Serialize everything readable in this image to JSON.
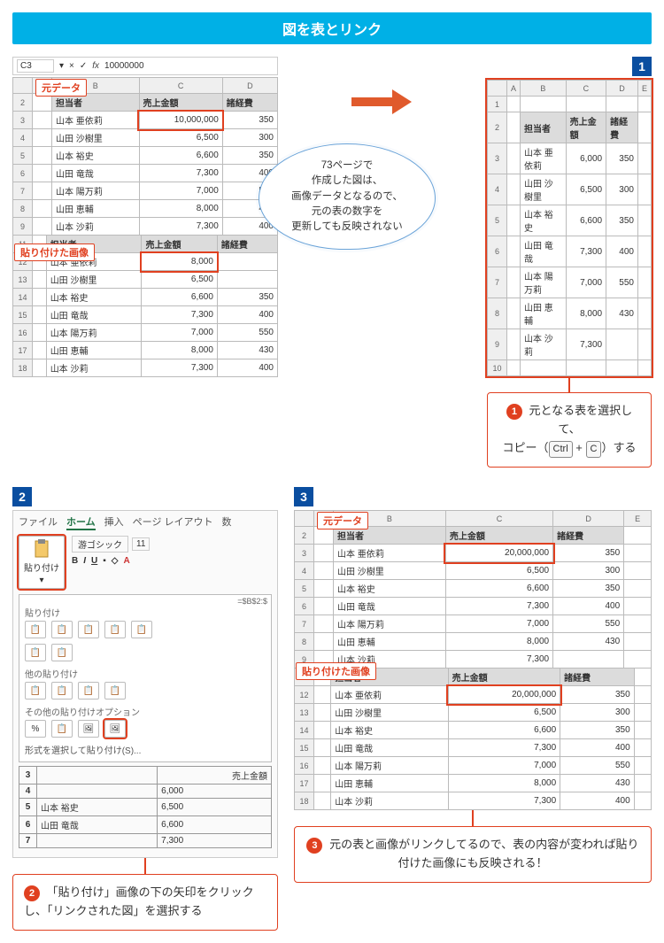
{
  "title": "図を表とリンク",
  "steps": {
    "s1": "1",
    "s2": "2",
    "s3": "3"
  },
  "badge_num": {
    "b1": "1",
    "b2": "2",
    "b3": "3"
  },
  "labels": {
    "source_data": "元データ",
    "pasted_image": "貼り付けた画像"
  },
  "bubble_text": "73ページで\n作成した図は、\n画像データとなるので、\n元の表の数字を\n更新しても反映されない",
  "callout1": {
    "pre": "元となる表を選択して、\nコピー（",
    "k1": "Ctrl",
    "plus": "+",
    "k2": "C",
    "post": "）する"
  },
  "callout2": "「貼り付け」画像の下の矢印をクリックし、「リンクされた図」を選択する",
  "callout3": "元の表と画像がリンクしてるので、表の内容が変われば貼り付けた画像にも反映される！",
  "formula": {
    "cellref": "C3",
    "fx_value": "10000000"
  },
  "columns": [
    "A",
    "B",
    "C",
    "D",
    "E"
  ],
  "headers": {
    "person": "担当者",
    "sales": "売上金額",
    "expense": "諸経費"
  },
  "table_original": [
    {
      "row": 3,
      "name": "山本 亜依莉",
      "sales": "10,000,000",
      "exp": "350"
    },
    {
      "row": 4,
      "name": "山田 沙樹里",
      "sales": "6,500",
      "exp": "300"
    },
    {
      "row": 5,
      "name": "山本 裕史",
      "sales": "6,600",
      "exp": "350"
    },
    {
      "row": 6,
      "name": "山田 竜哉",
      "sales": "7,300",
      "exp": "400"
    },
    {
      "row": 7,
      "name": "山本 陽万莉",
      "sales": "7,000",
      "exp": "550"
    },
    {
      "row": 8,
      "name": "山田 恵輔",
      "sales": "8,000",
      "exp": "430"
    },
    {
      "row": 9,
      "name": "山本 沙莉",
      "sales": "7,300",
      "exp": "400"
    }
  ],
  "table_pasted": [
    {
      "row": 12,
      "name": "山本 亜依莉",
      "sales": "8,000",
      "exp": ""
    },
    {
      "row": 13,
      "name": "山田 沙樹里",
      "sales": "6,500",
      "exp": ""
    },
    {
      "row": 14,
      "name": "山本 裕史",
      "sales": "6,600",
      "exp": "350"
    },
    {
      "row": 15,
      "name": "山田 竜哉",
      "sales": "7,300",
      "exp": "400"
    },
    {
      "row": 16,
      "name": "山本 陽万莉",
      "sales": "7,000",
      "exp": "550"
    },
    {
      "row": 17,
      "name": "山田 恵輔",
      "sales": "8,000",
      "exp": "430"
    },
    {
      "row": 18,
      "name": "山本 沙莉",
      "sales": "7,300",
      "exp": "400"
    }
  ],
  "table_step1": [
    {
      "row": 3,
      "name": "山本 亜依莉",
      "sales": "6,000",
      "exp": "350"
    },
    {
      "row": 4,
      "name": "山田 沙樹里",
      "sales": "6,500",
      "exp": "300"
    },
    {
      "row": 5,
      "name": "山本 裕史",
      "sales": "6,600",
      "exp": "350"
    },
    {
      "row": 6,
      "name": "山田 竜哉",
      "sales": "7,300",
      "exp": "400"
    },
    {
      "row": 7,
      "name": "山本 陽万莉",
      "sales": "7,000",
      "exp": "550"
    },
    {
      "row": 8,
      "name": "山田 恵輔",
      "sales": "8,000",
      "exp": "430"
    },
    {
      "row": 9,
      "name": "山本 沙莉",
      "sales": "7,300",
      "exp": ""
    }
  ],
  "table_step3_src": [
    {
      "row": 3,
      "name": "山本 亜依莉",
      "sales": "20,000,000",
      "exp": "350"
    },
    {
      "row": 4,
      "name": "山田 沙樹里",
      "sales": "6,500",
      "exp": "300"
    },
    {
      "row": 5,
      "name": "山本 裕史",
      "sales": "6,600",
      "exp": "350"
    },
    {
      "row": 6,
      "name": "山田 竜哉",
      "sales": "7,300",
      "exp": "400"
    },
    {
      "row": 7,
      "name": "山本 陽万莉",
      "sales": "7,000",
      "exp": "550"
    },
    {
      "row": 8,
      "name": "山田 恵輔",
      "sales": "8,000",
      "exp": "430"
    },
    {
      "row": 9,
      "name": "山本 沙莉",
      "sales": "7,300",
      "exp": ""
    }
  ],
  "table_step3_pasted": [
    {
      "row": 12,
      "name": "山本 亜依莉",
      "sales": "20,000,000",
      "exp": "350"
    },
    {
      "row": 13,
      "name": "山田 沙樹里",
      "sales": "6,500",
      "exp": "300"
    },
    {
      "row": 14,
      "name": "山本 裕史",
      "sales": "6,600",
      "exp": "350"
    },
    {
      "row": 15,
      "name": "山田 竜哉",
      "sales": "7,300",
      "exp": "400"
    },
    {
      "row": 16,
      "name": "山本 陽万莉",
      "sales": "7,000",
      "exp": "550"
    },
    {
      "row": 17,
      "name": "山田 恵輔",
      "sales": "8,000",
      "exp": "430"
    },
    {
      "row": 18,
      "name": "山本 沙莉",
      "sales": "7,300",
      "exp": "400"
    }
  ],
  "ribbon": {
    "tabs": [
      "ファイル",
      "ホーム",
      "挿入",
      "ページ レイアウト",
      "数"
    ],
    "font": "游ゴシック",
    "font_size": "11",
    "paste_label": "貼り付け",
    "sec_paste": "貼り付け",
    "sec_other_paste": "他の貼り付け",
    "sec_paste_options": "その他の貼り付けオプション",
    "format_link": "形式を選択して貼り付け(S)...",
    "formula_ref": "=$B$2:$",
    "visible_sales": [
      "6,000",
      "6,500",
      "6,600",
      "7,300"
    ],
    "visible_names": [
      "山本 裕史",
      "山田 竜哉"
    ],
    "sales_header": "売上金額"
  }
}
